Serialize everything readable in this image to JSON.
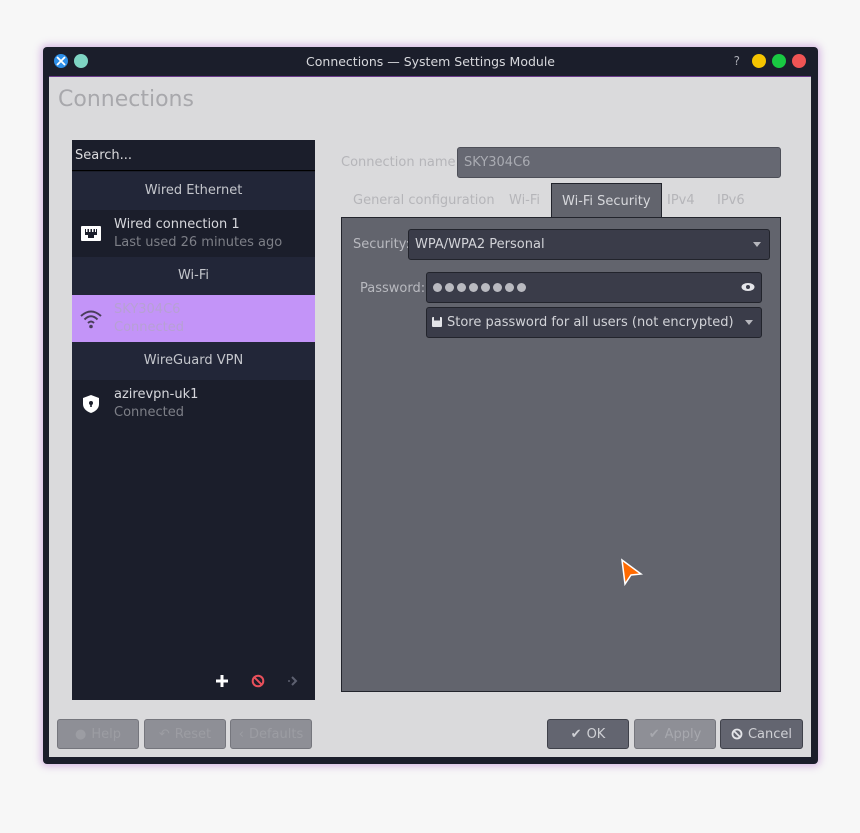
{
  "window": {
    "title": "Connections — System Settings Module",
    "help_label": "?",
    "colors": {
      "minimize": "#f5c400",
      "maximize": "#19c942",
      "close": "#f05454",
      "pin": "#7fd4c3",
      "accent": "#c394f8"
    }
  },
  "page": {
    "title": "Connections"
  },
  "sidebar": {
    "search_placeholder": "Search...",
    "groups": [
      {
        "header": "Wired Ethernet",
        "items": [
          {
            "name": "Wired connection 1",
            "status": "Last used 26 minutes ago",
            "icon": "ethernet-icon"
          }
        ]
      },
      {
        "header": "Wi-Fi",
        "items": [
          {
            "name": "SKY304C6",
            "status": "Connected",
            "icon": "wifi-icon",
            "selected": true
          }
        ]
      },
      {
        "header": "WireGuard VPN",
        "items": [
          {
            "name": "azirevpn-uk1",
            "status": "Connected",
            "icon": "shield-icon"
          }
        ]
      }
    ],
    "actions": [
      "add-icon",
      "remove-icon",
      "export-icon"
    ]
  },
  "editor": {
    "connection_name_label": "Connection name:",
    "connection_name_value": "SKY304C6",
    "tabs": [
      "General configuration",
      "Wi-Fi",
      "Wi-Fi Security",
      "IPv4",
      "IPv6"
    ],
    "active_tab": "Wi-Fi Security",
    "security_label": "Security:",
    "security_value": "WPA/WPA2 Personal",
    "password_label": "Password:",
    "password_masked_length": 8,
    "store_option": "Store password for all users (not encrypted)"
  },
  "buttons": {
    "help": "Help",
    "reset": "Reset",
    "defaults": "Defaults",
    "ok": "OK",
    "apply": "Apply",
    "cancel": "Cancel"
  }
}
